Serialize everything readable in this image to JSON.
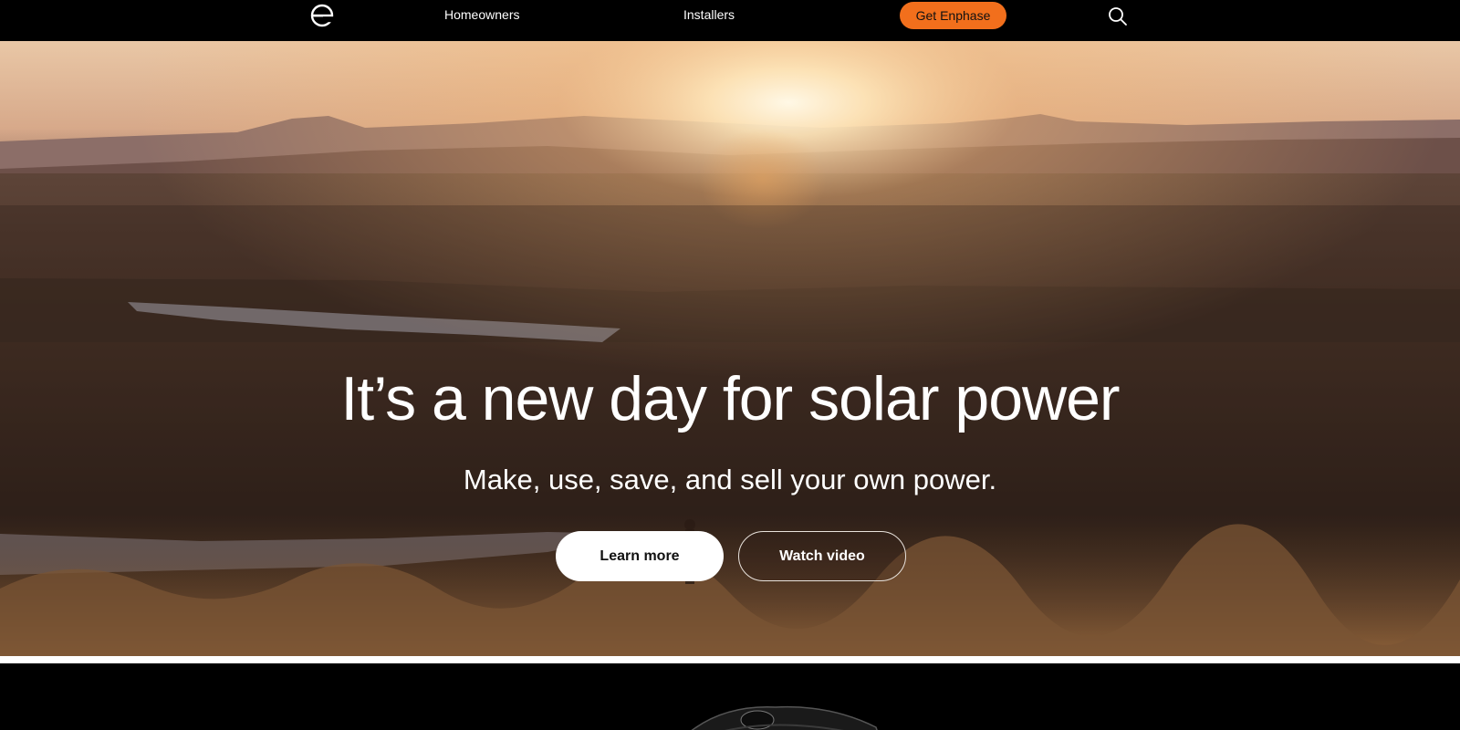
{
  "nav": {
    "logo_icon": "enphase-logo-icon",
    "links": {
      "homeowners": "Homeowners",
      "installers": "Installers"
    },
    "cta_label": "Get Enphase",
    "search_icon": "search-icon"
  },
  "hero": {
    "title": "It’s a new day for solar power",
    "subtitle": "Make, use, save, and sell your own power.",
    "primary_button": "Learn more",
    "secondary_button": "Watch video",
    "background_image": "sunset-over-mountains-and-lakes-photo"
  },
  "next_section": {
    "image": "enphase-device-product-image"
  },
  "colors": {
    "accent": "#f26f1c",
    "nav_background": "#000000",
    "button_primary_bg": "#ffffff"
  }
}
